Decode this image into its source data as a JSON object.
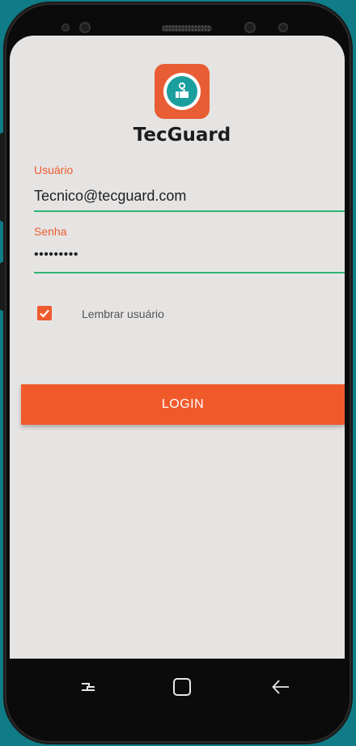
{
  "app": {
    "title": "TecGuard"
  },
  "login_form": {
    "user_label": "Usuário",
    "user_value": "Tecnico@tecguard.com",
    "password_label": "Senha",
    "password_value": "•••••••••",
    "remember_label": "Lembrar usuário",
    "remember_checked": true,
    "login_button": "LOGIN"
  },
  "nav": {
    "items": [
      "recent-apps-icon",
      "home-icon",
      "back-icon"
    ]
  },
  "colors": {
    "accent": "#ee5a2e",
    "field_underline": "#2bb673",
    "logo_teal": "#1a9e9e",
    "background": "#e6e4e3"
  }
}
